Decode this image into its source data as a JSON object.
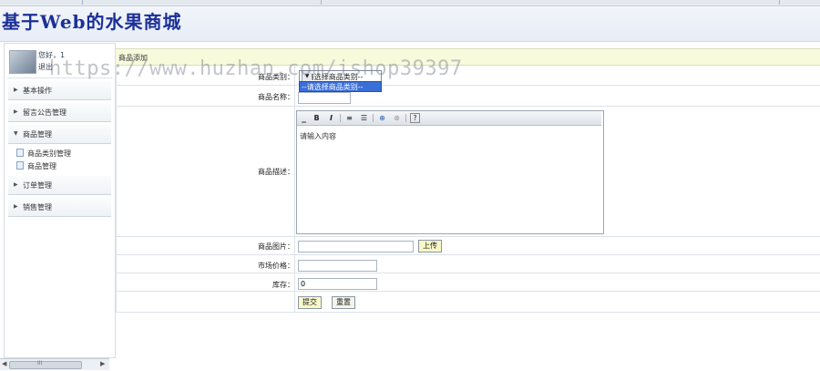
{
  "app": {
    "title": "基于Web的水果商城"
  },
  "user": {
    "greeting": "您好，1",
    "logout_label": "退出"
  },
  "sidebar": {
    "groups": [
      {
        "label": "基本操作"
      },
      {
        "label": "留言公告管理"
      },
      {
        "label": "商品管理"
      },
      {
        "label": "订单管理"
      },
      {
        "label": "销售管理"
      }
    ],
    "subitems": [
      {
        "label": "商品类别管理"
      },
      {
        "label": "商品管理"
      }
    ]
  },
  "form": {
    "header": "商品添加",
    "category": {
      "label": "商品类别：",
      "selected": "--请选择商品类别--",
      "options": [
        "--请选择商品类别--"
      ]
    },
    "name": {
      "label": "商品名称：",
      "value": ""
    },
    "description": {
      "label": "商品描述：",
      "placeholder": "请输入内容"
    },
    "image": {
      "label": "商品图片：",
      "value": "",
      "upload_label": "上传"
    },
    "market_price": {
      "label": "市场价格：",
      "value": ""
    },
    "stock": {
      "label": "库存：",
      "value": "0"
    },
    "submit_label": "提交",
    "reset_label": "重置"
  },
  "editor_toolbar": [
    "B",
    "I",
    "≡",
    "☰",
    "⊕",
    "⊗",
    "?"
  ],
  "watermark": "https://www.huzhan.com/ishop39397",
  "scrollbar": {
    "thumb_label": "III"
  },
  "colors": {
    "title": "#1b2f97",
    "form_header_bg": "#f7fbdc",
    "dropdown_highlight": "#3a6fd8"
  }
}
